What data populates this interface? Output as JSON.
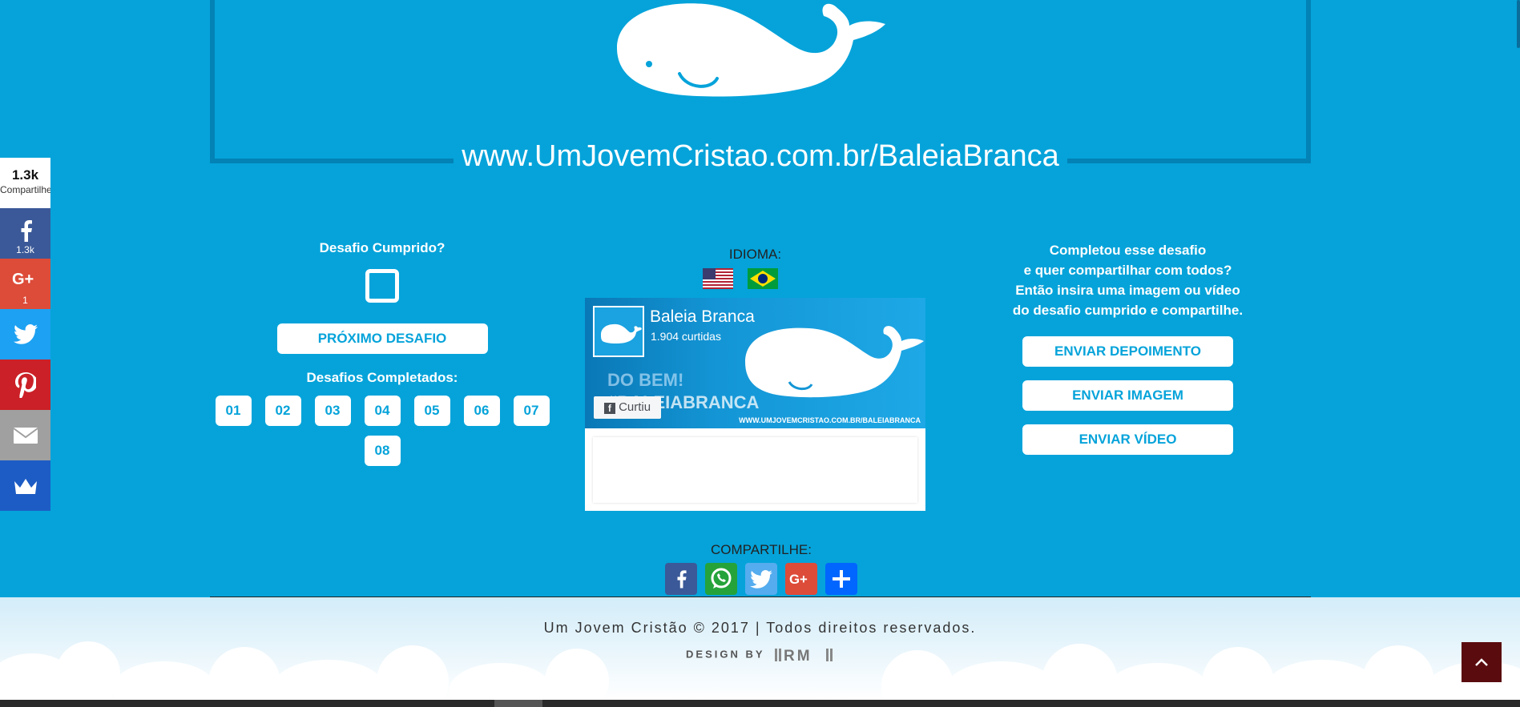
{
  "banner": {
    "url": "www.UmJovemCristao.com.br/BaleiaBranca"
  },
  "sidebar": {
    "total_count": "1.3k",
    "total_label": "Compartilhe",
    "buttons": [
      {
        "network": "facebook",
        "icon": "facebook-icon",
        "count": "1.3k",
        "color": "#3b5998"
      },
      {
        "network": "google-plus",
        "icon": "google-plus-icon",
        "count": "1",
        "color": "#dd4b39"
      },
      {
        "network": "twitter",
        "icon": "twitter-icon",
        "count": "",
        "color": "#1da1f2"
      },
      {
        "network": "pinterest",
        "icon": "pinterest-icon",
        "count": "",
        "color": "#cb2027"
      },
      {
        "network": "email",
        "icon": "mail-icon",
        "count": "",
        "color": "#a0a0a0"
      },
      {
        "network": "sumo",
        "icon": "crown-icon",
        "count": "",
        "color": "#1d5cc4"
      }
    ]
  },
  "left": {
    "challenge_title": "Desafio Cumprido?",
    "next_button": "PRÓXIMO DESAFIO",
    "completed_title": "Desafios Completados:",
    "days": [
      "01",
      "02",
      "03",
      "04",
      "05",
      "06",
      "07",
      "08"
    ]
  },
  "middle": {
    "language_label": "IDIOMA:",
    "flags": [
      "us-flag",
      "brazil-flag"
    ],
    "facebook": {
      "page_name": "Baleia Branca",
      "likes": "1.904 curtidas",
      "liked_button": "Curtiu",
      "cover_text_1": "DO BEM!",
      "cover_text_2": "#BALEIABRANCA",
      "cover_url": "WWW.UMJOVEMCRISTAO.COM.BR/BALEIABRANCA"
    }
  },
  "right": {
    "text_lines": [
      "Completou esse desafio",
      "e quer compartilhar com todos?",
      "Então insira uma imagem ou vídeo",
      "do desafio cumprido e compartilhe."
    ],
    "buttons": [
      "ENVIAR DEPOIMENTO",
      "ENVIAR IMAGEM",
      "ENVIAR VÍDEO"
    ]
  },
  "share": {
    "title": "COMPARTILHE:",
    "icons": [
      {
        "name": "facebook-icon",
        "color": "#3b5998"
      },
      {
        "name": "whatsapp-icon",
        "color": "#25a33a"
      },
      {
        "name": "twitter-icon",
        "color": "#55acee"
      },
      {
        "name": "google-plus-icon",
        "color": "#dd4b39"
      },
      {
        "name": "plus-icon",
        "color": "#0166ff"
      }
    ]
  },
  "footer": {
    "copyright": "Um Jovem Cristão © 2017 | Todos direitos reservados.",
    "design_by": "DESIGN BY"
  },
  "colors": {
    "background": "#05a3da",
    "frame": "#0382b5",
    "to_top": "#5a0b0e"
  }
}
